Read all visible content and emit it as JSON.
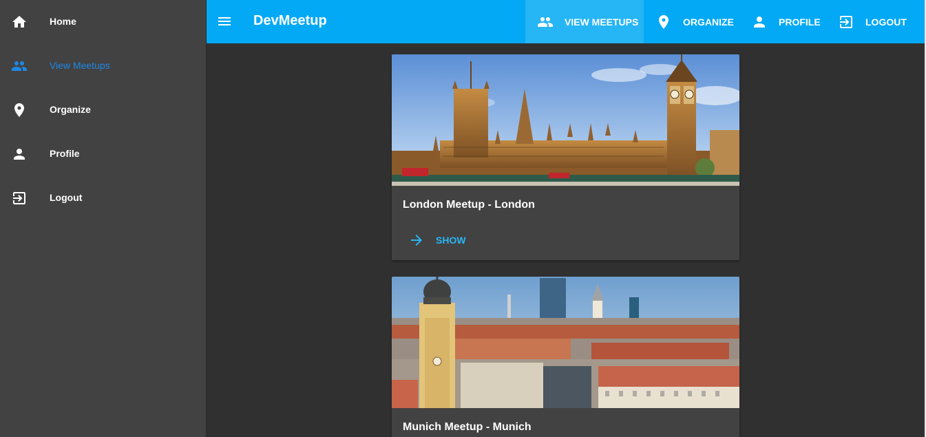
{
  "colors": {
    "toolbar": "#03a9f4",
    "sidebar": "#424242",
    "background": "#303030",
    "active_accent": "#1e88e5",
    "button_accent": "#29b6f6"
  },
  "sidebar": {
    "items": [
      {
        "label": "Home",
        "icon": "home-icon"
      },
      {
        "label": "View Meetups",
        "icon": "people-icon",
        "active": true
      },
      {
        "label": "Organize",
        "icon": "location-pin-icon"
      },
      {
        "label": "Profile",
        "icon": "person-icon"
      },
      {
        "label": "Logout",
        "icon": "exit-to-app-icon"
      }
    ]
  },
  "toolbar": {
    "menu_icon": "menu-icon",
    "title": "DevMeetup",
    "buttons": [
      {
        "label": "VIEW MEETUPS",
        "icon": "people-icon",
        "active": true
      },
      {
        "label": "ORGANIZE",
        "icon": "location-pin-icon"
      },
      {
        "label": "PROFILE",
        "icon": "person-icon"
      },
      {
        "label": "LOGOUT",
        "icon": "exit-to-app-icon"
      }
    ]
  },
  "meetups": [
    {
      "title": "London Meetup - London",
      "image": "london-parliament-photo",
      "action_label": "SHOW",
      "action_icon": "arrow-forward-icon"
    },
    {
      "title": "Munich Meetup - Munich",
      "image": "munich-city-photo"
    }
  ]
}
